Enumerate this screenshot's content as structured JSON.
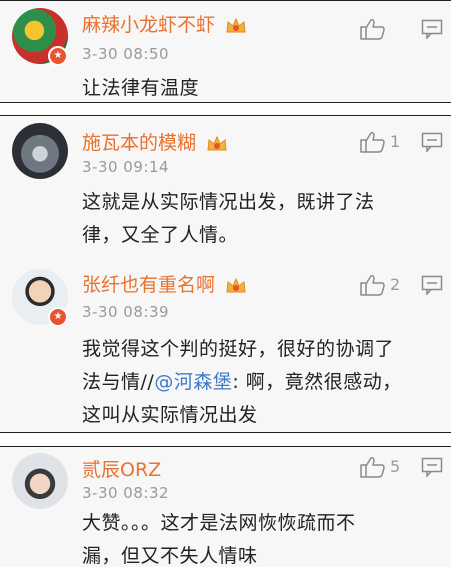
{
  "comments": [
    {
      "name": "麻辣小龙虾不虾",
      "time": "3-30 08:50",
      "text": "让法律有温度",
      "likes": ""
    },
    {
      "name": "施瓦本的模糊",
      "time": "3-30 09:14",
      "text_lines": [
        "这就是从实际情况出发，既讲了法",
        "律，又全了人情。"
      ],
      "likes": "1"
    },
    {
      "name": "张纤也有重名啊",
      "time": "3-30 08:39",
      "line1": "我觉得这个判的挺好，很好的协调了",
      "line2_pre": "法与情//",
      "mention": "@河森堡",
      "line2_post": ": 啊，竟然很感动，",
      "line3": "这叫从实际情况出发",
      "likes": "2"
    },
    {
      "name": "贰辰ORZ",
      "time": "3-30 08:32",
      "text_lines": [
        "大赞。。。这才是法网恢恢疏而不",
        "漏，但又不失人情味"
      ],
      "likes": "5"
    }
  ],
  "colors": {
    "name": "#e8722e",
    "mention": "#3e79c7",
    "time": "#9a9a9a",
    "badge": "#e8542e"
  },
  "icons": [
    "crown-badge-icon",
    "thumbs-up-icon",
    "reply-comment-icon",
    "verified-badge-icon"
  ]
}
